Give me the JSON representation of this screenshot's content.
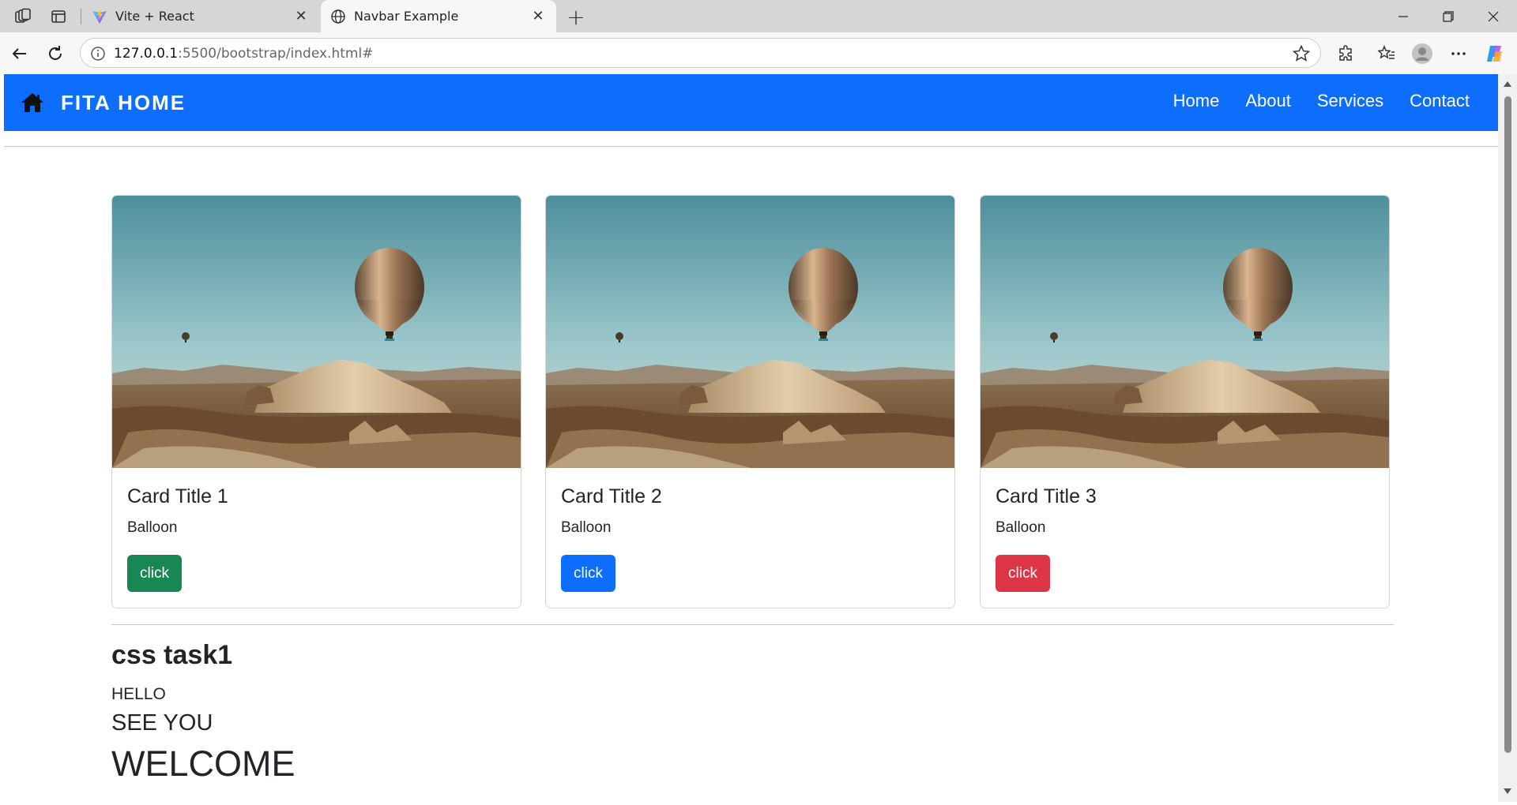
{
  "browser": {
    "tabs": [
      {
        "title": "Vite + React",
        "favicon": "vite-logo-icon",
        "active": false
      },
      {
        "title": "Navbar Example",
        "favicon": "globe-icon",
        "active": true
      }
    ],
    "url_host": "127.0.0.1",
    "url_rest": ":5500/bootstrap/index.html#"
  },
  "navbar": {
    "brand": "FITA HOME",
    "brand_icon": "home-icon",
    "links": [
      "Home",
      "About",
      "Services",
      "Contact"
    ],
    "color": "#0d6efd"
  },
  "cards": [
    {
      "title": "Card Title 1",
      "text": "Balloon",
      "button": "click",
      "button_color": "#198754"
    },
    {
      "title": "Card Title 2",
      "text": "Balloon",
      "button": "click",
      "button_color": "#0d6efd"
    },
    {
      "title": "Card Title 3",
      "text": "Balloon",
      "button": "click",
      "button_color": "#dc3545"
    }
  ],
  "section": {
    "heading": "css task1",
    "line1": "HELLO",
    "line2": "SEE YOU",
    "line3": "WELCOME"
  }
}
